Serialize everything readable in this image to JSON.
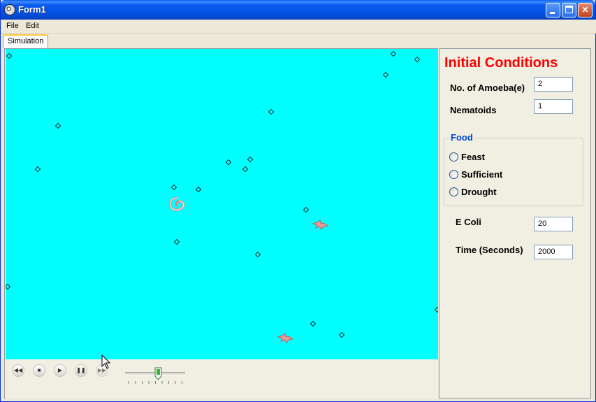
{
  "window": {
    "title": "Form1"
  },
  "titlebar_buttons": {
    "minimize": "",
    "maximize": "",
    "close": "✕"
  },
  "menu": {
    "items": [
      "File",
      "Edit"
    ]
  },
  "tabs": [
    {
      "label": "Simulation",
      "active": true
    }
  ],
  "colors": {
    "canvas": "#00ffff",
    "heading": "#ff0000",
    "group_title": "#0046d5"
  },
  "playback": {
    "buttons": [
      "◀◀",
      "■",
      "▶",
      "❚❚",
      "▶▶"
    ],
    "speed_level": 0.55
  },
  "initial_conditions": {
    "title": "Initial Conditions",
    "amoeba": {
      "label": "No. of Amoeba(e)",
      "value": "2"
    },
    "nematoids": {
      "label": "Nematoids",
      "value": "1"
    },
    "food": {
      "title": "Food",
      "options": [
        "Feast",
        "Sufficient",
        "Drought"
      ],
      "selected": null
    },
    "ecoli": {
      "label": "E Coli",
      "value": "20"
    },
    "time": {
      "label": "Time (Seconds)",
      "value": "2000"
    }
  }
}
